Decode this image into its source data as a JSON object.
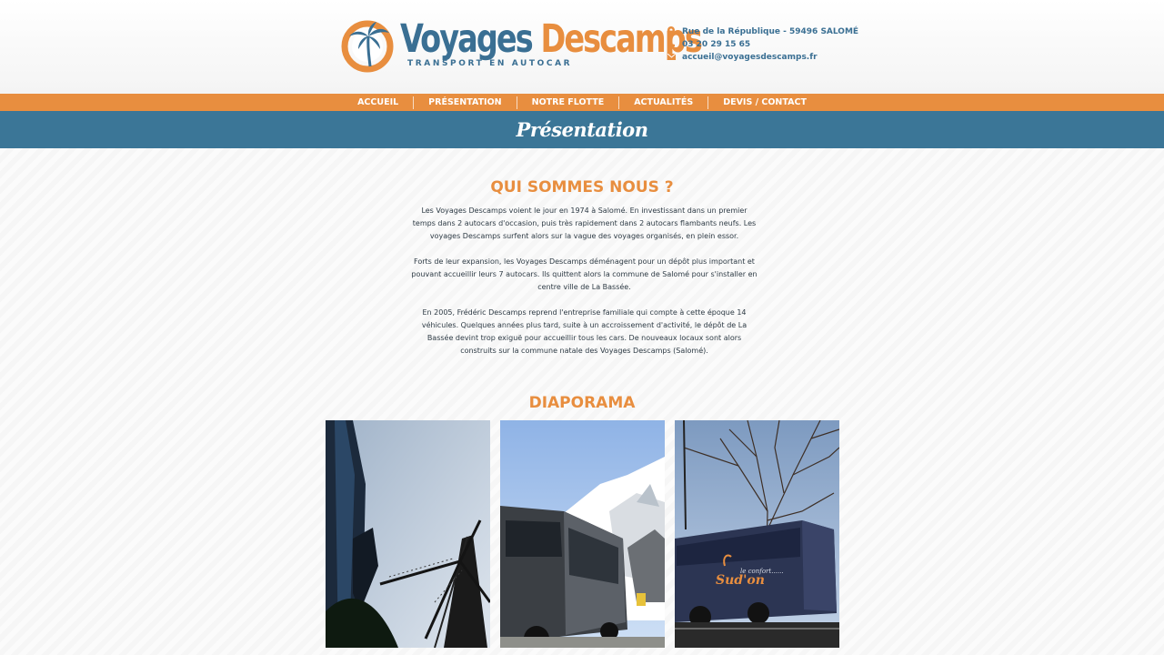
{
  "brand": {
    "name_part1": "Voyages",
    "name_part2": "Descamps",
    "tagline": "TRANSPORT EN AUTOCAR",
    "primary_color": "#3a6f93",
    "accent_color": "#e88e3f"
  },
  "contact": {
    "address": "Rue de la République - 59496 SALOMÉ",
    "phone": "03 20 29 15 65",
    "email": "accueil@voyagesdescamps.fr",
    "address_icon": "map-pin-icon",
    "phone_icon": "phone-icon",
    "email_icon": "envelope-icon"
  },
  "nav": {
    "items": [
      {
        "label": "ACCUEIL"
      },
      {
        "label": "PRÉSENTATION"
      },
      {
        "label": "NOTRE FLOTTE"
      },
      {
        "label": "ACTUALITÉS"
      },
      {
        "label": "DEVIS / CONTACT"
      }
    ]
  },
  "banner": {
    "title": "Présentation"
  },
  "about": {
    "title": "QUI SOMMES NOUS ?",
    "paragraphs": [
      "Les Voyages Descamps voient le jour en 1974 à Salomé. En investissant dans un premier temps dans 2 autocars d'occasion, puis très rapidement dans 2 autocars flambants neufs. Les voyages Descamps surfent alors sur la vague des voyages organisés, en plein essor.",
      "Forts de leur expansion, les Voyages Descamps déménagent pour un dépôt plus important et pouvant accueillir leurs 7 autocars. Ils quittent alors la commune de Salomé pour s'installer en centre ville de La Bassée.",
      "En 2005, Frédéric Descamps reprend l'entreprise familiale qui compte à cette époque 14 véhicules. Quelques années plus tard, suite à un accroissement d'activité, le dépôt de La Bassée devint trop exiguë pour accueillir tous les cars. De nouveaux locaux sont alors construits sur la commune natale des Voyages Descamps (Salomé)."
    ]
  },
  "diaporama": {
    "title": "DIAPORAMA",
    "photo3_caption": "le confort......"
  }
}
